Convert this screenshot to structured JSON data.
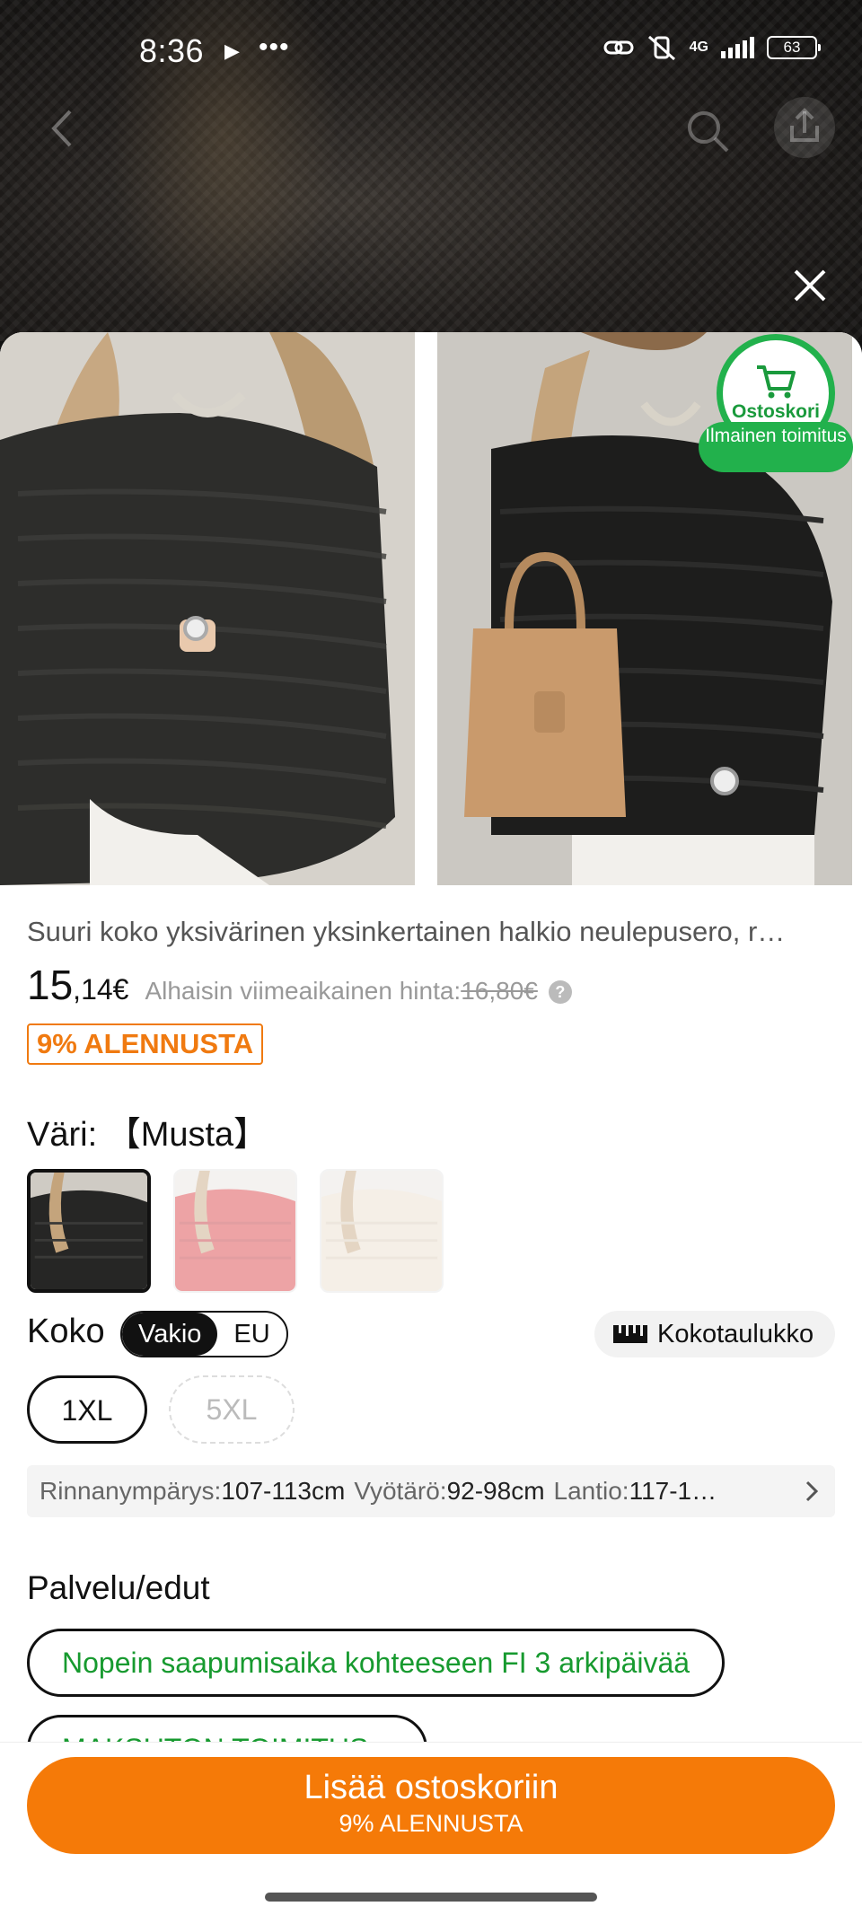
{
  "status_bar": {
    "time": "8:36",
    "play_glyph": "▶",
    "dots": "•••",
    "network": "4G",
    "battery": "63"
  },
  "nav": {
    "back_icon": "chevron-left-icon",
    "search_icon": "search-icon",
    "share_icon": "share-icon"
  },
  "sheet": {
    "close_icon": "close-icon",
    "badge": {
      "cart_label": "Ostoskori",
      "ship_label": "Ilmainen toimitus"
    },
    "product": {
      "title": "Suuri koko yksivärinen yksinkertainen halkio neulepusero, r…",
      "price_int": "15",
      "price_dec": ",14",
      "price_currency": "€",
      "lowest_label": "Alhaisin viimeaikainen hinta:",
      "old_price": "16,80€",
      "help_glyph": "?",
      "discount": "9% ALENNUSTA"
    },
    "color": {
      "label": "Väri:  【Musta】",
      "options": [
        "Musta",
        "Punainen",
        "Beige"
      ],
      "selected_index": 0
    },
    "size": {
      "label": "Koko",
      "systems": [
        "Vakio",
        "EU"
      ],
      "selected_system": "Vakio",
      "chart_label": "Kokotaulukko",
      "options": [
        {
          "label": "1XL",
          "state": "selected"
        },
        {
          "label": "5XL",
          "state": "unavailable"
        }
      ]
    },
    "measurements": {
      "chest_key": "Rinnanympärys: ",
      "chest_val": "107-113cm",
      "waist_key": "Vyötärö: ",
      "waist_val": "92-98cm",
      "hip_key": "Lantio: ",
      "hip_val": "117-1…"
    },
    "services": {
      "title": "Palvelu/edut",
      "items": [
        "Nopein saapumisaika kohteeseen FI 3 arkipäivää",
        "MAKSUTON TOIMITUS"
      ]
    },
    "cta": {
      "main": "Lisää ostoskoriin",
      "sub": "9% ALENNUSTA"
    }
  },
  "colors": {
    "accent_orange": "#f57a08",
    "discount_orange": "#f07a10",
    "green": "#22b14c",
    "service_green": "#179a2f"
  }
}
